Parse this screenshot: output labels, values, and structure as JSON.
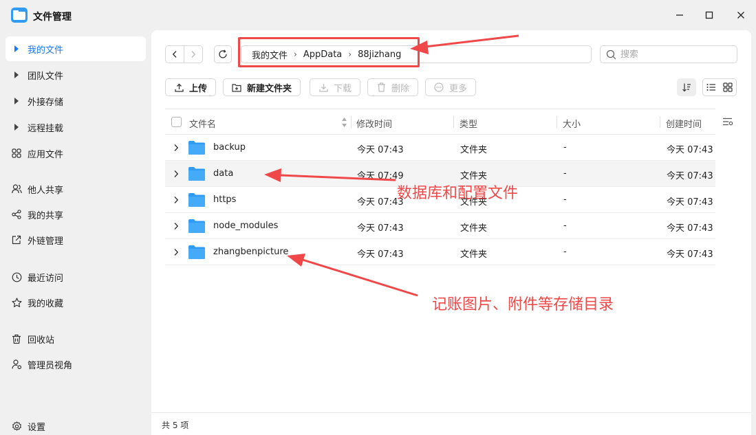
{
  "window": {
    "title": "文件管理",
    "controls": {
      "minimize": "minimize-icon",
      "maximize": "maximize-icon",
      "close": "close-icon"
    }
  },
  "sidebar": {
    "items": [
      {
        "label": "我的文件",
        "icon": "triangle-right-icon",
        "active": true
      },
      {
        "label": "团队文件",
        "icon": "triangle-right-icon"
      },
      {
        "label": "外接存储",
        "icon": "triangle-right-icon"
      },
      {
        "label": "远程挂载",
        "icon": "triangle-right-icon"
      },
      {
        "label": "应用文件",
        "icon": "apps-grid-icon"
      },
      {
        "label": "他人共享",
        "icon": "users-icon"
      },
      {
        "label": "我的共享",
        "icon": "share-icon"
      },
      {
        "label": "外链管理",
        "icon": "external-link-icon"
      },
      {
        "label": "最近访问",
        "icon": "clock-icon"
      },
      {
        "label": "我的收藏",
        "icon": "star-icon"
      },
      {
        "label": "回收站",
        "icon": "trash-icon"
      },
      {
        "label": "管理员视角",
        "icon": "admin-icon"
      },
      {
        "label": "设置",
        "icon": "gear-icon"
      }
    ]
  },
  "breadcrumb": [
    "我的文件",
    "AppData",
    "88jizhang"
  ],
  "search": {
    "placeholder": "搜索"
  },
  "toolbar": {
    "upload": "上传",
    "new_folder": "新建文件夹",
    "download": "下载",
    "delete": "删除",
    "more": "更多"
  },
  "table": {
    "columns": {
      "name": "文件名",
      "modified": "修改时间",
      "type": "类型",
      "size": "大小",
      "created": "创建时间"
    },
    "rows": [
      {
        "name": "backup",
        "modified": "今天 07:43",
        "type": "文件夹",
        "size": "-",
        "created": "今天 07:43"
      },
      {
        "name": "data",
        "modified": "今天 07:49",
        "type": "文件夹",
        "size": "-",
        "created": "今天 07:43"
      },
      {
        "name": "https",
        "modified": "今天 07:43",
        "type": "文件夹",
        "size": "-",
        "created": "今天 07:43"
      },
      {
        "name": "node_modules",
        "modified": "今天 07:43",
        "type": "文件夹",
        "size": "-",
        "created": "今天 07:43"
      },
      {
        "name": "zhangbenpicture",
        "modified": "今天 07:43",
        "type": "文件夹",
        "size": "-",
        "created": "今天 07:43"
      }
    ]
  },
  "footer": {
    "count": "共 5 项"
  },
  "annotations": {
    "data_note": "数据库和配置文件",
    "picture_note": "记账图片、附件等存储目录",
    "color": "#f04848"
  },
  "colors": {
    "accent": "#1677ff",
    "folder": "#2f9bf5"
  }
}
